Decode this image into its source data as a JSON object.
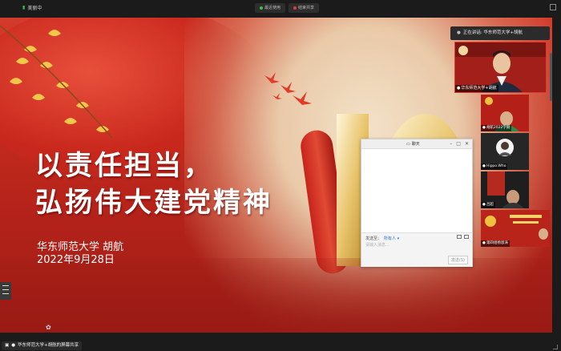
{
  "app": {
    "title": "美丽中"
  },
  "top_controls": [
    {
      "label": "最近使用",
      "status": "active"
    },
    {
      "label": "结束共享"
    }
  ],
  "slide": {
    "headline_line1": "以责任担当，",
    "headline_line2": "弘扬伟大建党精神",
    "institution_speaker": "华东师范大学  胡航",
    "date": "2022年9月28日"
  },
  "chat": {
    "title": "聊天",
    "send_to_label": "发送至：",
    "send_to_value": "所有人 ▾",
    "input_placeholder": "请输入消息…",
    "send_button": "发送(S)"
  },
  "participants": {
    "speaking_label": "正在讲话: 华东师范大学+胡航",
    "main_tile_name": "华东师范大学+胡航",
    "tiles": [
      {
        "name": "胡航2022学期"
      },
      {
        "name": "Hippo.Who"
      },
      {
        "name": "吕超"
      },
      {
        "name": "第四组杨恩涛"
      }
    ]
  },
  "status_bar": {
    "share_label": "华东师范大学+胡航的屏幕共享"
  },
  "colors": {
    "accent_red": "#c72d20",
    "active_green": "#39c24a",
    "link_blue": "#2d6fd6"
  }
}
